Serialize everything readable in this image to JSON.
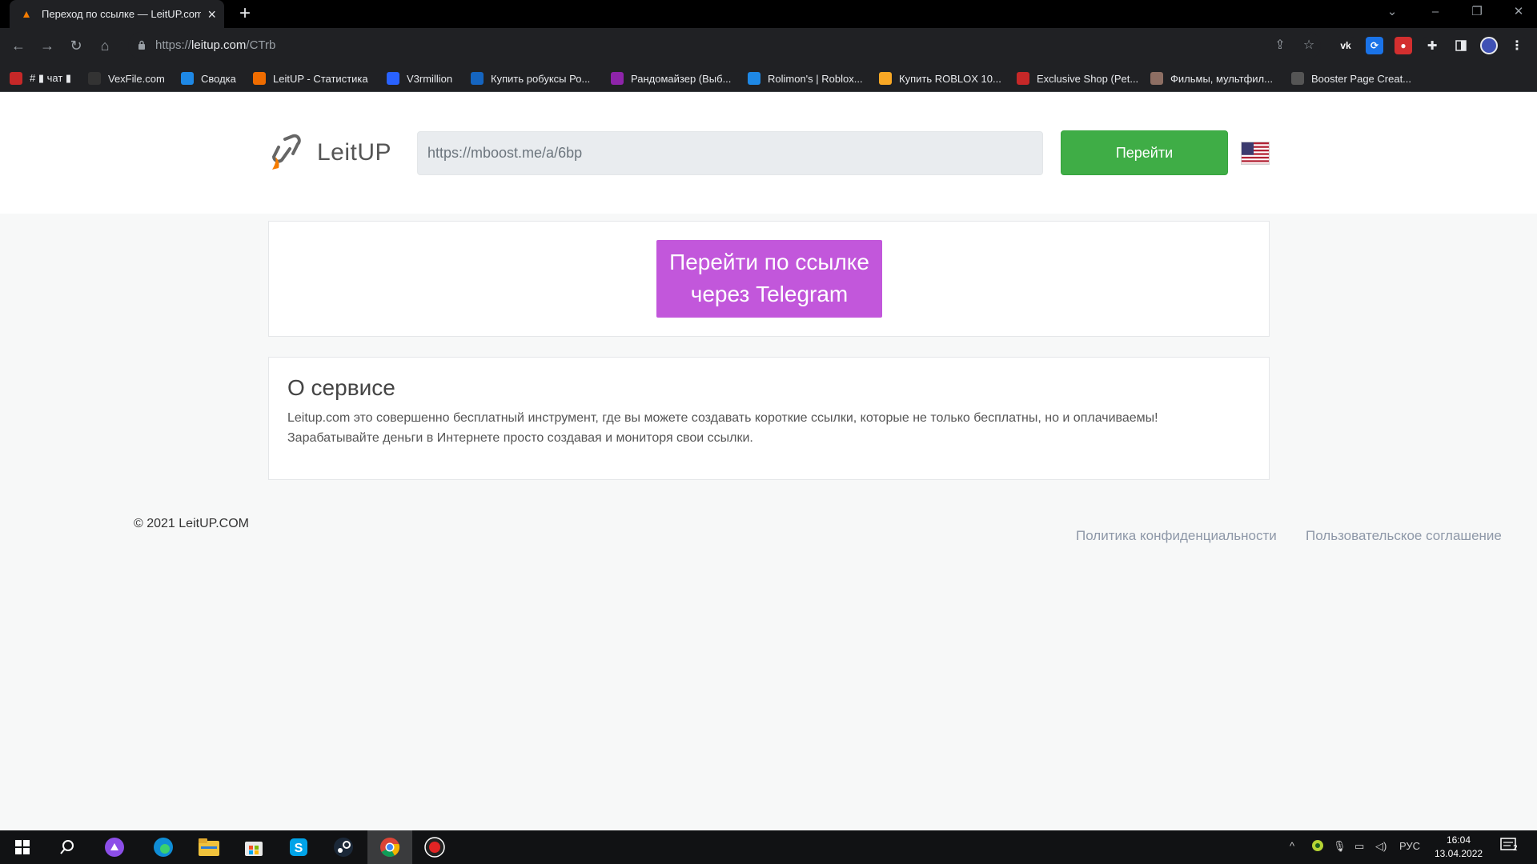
{
  "browser": {
    "tab_title": "Переход по ссылке — LeitUP.com",
    "url_prefix": "https://",
    "url_host": "leitup.com",
    "url_path": "/CTrb",
    "bookmarks": [
      {
        "label": "# ▮ чат ▮",
        "color": "#c62828",
        "icon": "chat-icon"
      },
      {
        "label": "VexFile.com",
        "color": "#333333",
        "icon": "vexfile-icon"
      },
      {
        "label": "Сводка",
        "color": "#1e88e5",
        "icon": "svodka-icon"
      },
      {
        "label": "LeitUP - Статистика",
        "color": "#ef6c00",
        "icon": "leitup-icon"
      },
      {
        "label": "V3rmillion",
        "color": "#2962ff",
        "icon": "v3rmillion-icon"
      },
      {
        "label": "Купить робуксы Ро...",
        "color": "#1565c0",
        "icon": "robux-icon"
      },
      {
        "label": "Рандомайзер (Выб...",
        "color": "#8e24aa",
        "icon": "randomizer-icon"
      },
      {
        "label": "Rolimon's | Roblox...",
        "color": "#1e88e5",
        "icon": "rolimons-icon"
      },
      {
        "label": "Купить ROBLOX 10...",
        "color": "#f9a825",
        "icon": "roblox-shop-icon"
      },
      {
        "label": "Exclusive Shop (Pet...",
        "color": "#c62828",
        "icon": "exclusive-shop-icon"
      },
      {
        "label": "Фильмы, мультфил...",
        "color": "#8d6e63",
        "icon": "films-icon"
      },
      {
        "label": "Booster Page Creat...",
        "color": "#555555",
        "icon": "booster-icon"
      }
    ]
  },
  "page": {
    "logo_text": "LeitUP",
    "url_input_value": "https://mboost.me/a/6bp",
    "go_button": "Перейти",
    "telegram_button_line1": "Перейти по ссылке",
    "telegram_button_line2": "через Telegram",
    "about_title": "О сервисе",
    "about_line1": "Leitup.com это совершенно бесплатный инструмент, где вы можете создавать короткие ссылки, которые не только бесплатны, но и оплачиваемы!",
    "about_line2": "Зарабатывайте деньги в Интернете просто создавая и мониторя свои ссылки.",
    "copyright": "© 2021 LeitUP.COM",
    "footer_links": [
      "Политика конфиденциальности",
      "Пользовательское соглашение"
    ],
    "colors": {
      "go_button": "#3fad46",
      "telegram_button": "#c257db"
    }
  },
  "taskbar": {
    "language": "РУС",
    "time": "16:04",
    "date": "13.04.2022",
    "notifications": "2"
  }
}
